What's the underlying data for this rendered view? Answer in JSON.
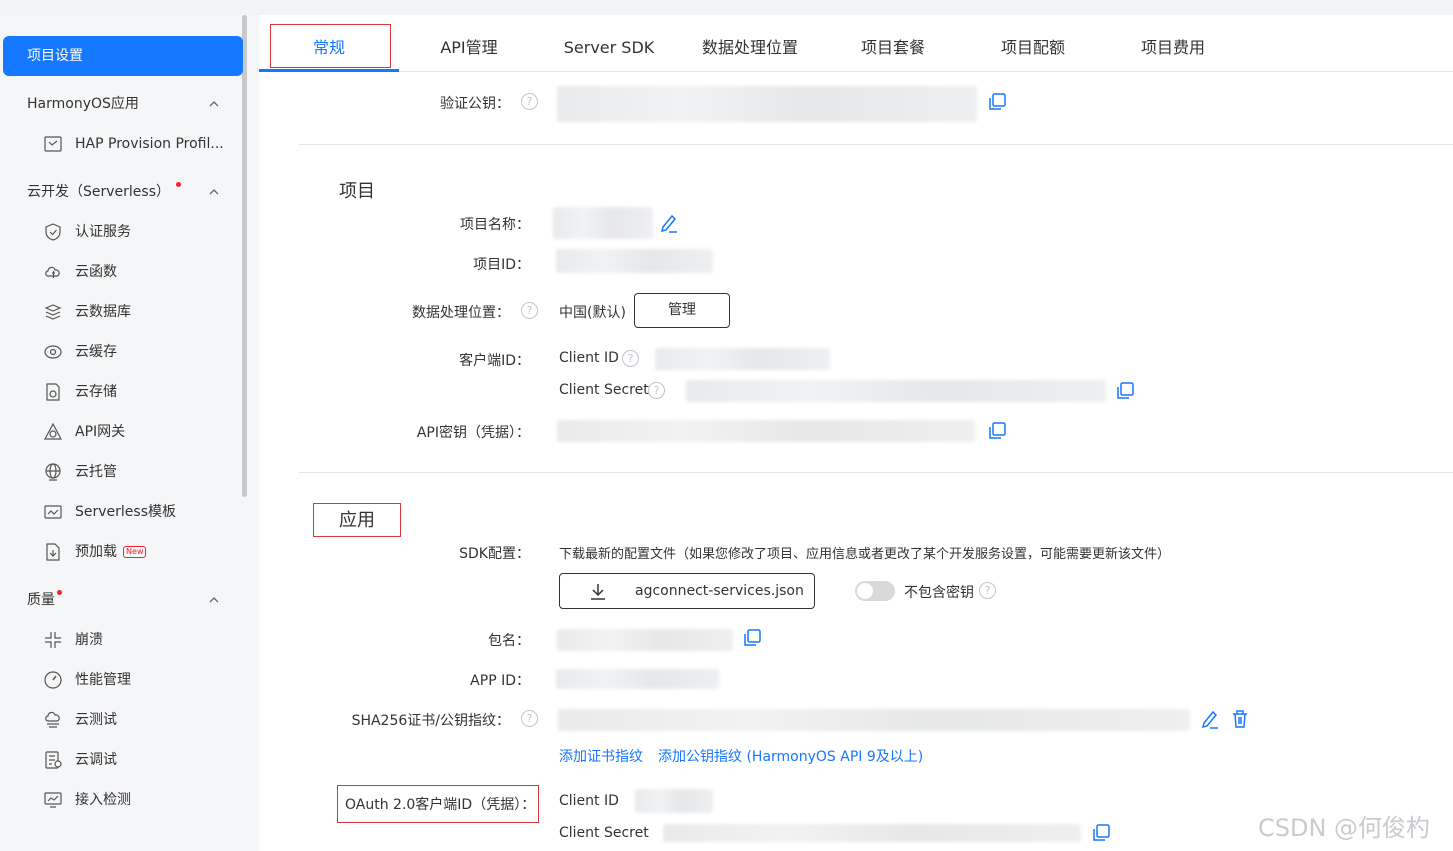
{
  "sidebar": {
    "active": "项目设置",
    "groups": [
      {
        "label": "HarmonyOS应用",
        "dot": false
      },
      {
        "label": "云开发（Serverless）",
        "dot": true
      },
      {
        "label": "质量",
        "dot": true
      }
    ],
    "items": [
      {
        "label": "HAP Provision Profil...",
        "icon": "profile-icon"
      },
      {
        "label": "认证服务",
        "icon": "shield-icon"
      },
      {
        "label": "云函数",
        "icon": "cloud-function-icon"
      },
      {
        "label": "云数据库",
        "icon": "database-icon"
      },
      {
        "label": "云缓存",
        "icon": "cache-icon"
      },
      {
        "label": "云存储",
        "icon": "storage-icon"
      },
      {
        "label": "API网关",
        "icon": "gateway-icon"
      },
      {
        "label": "云托管",
        "icon": "globe-icon"
      },
      {
        "label": "Serverless模板",
        "icon": "template-icon"
      },
      {
        "label": "预加载",
        "icon": "preload-icon",
        "badge": "New"
      },
      {
        "label": "崩溃",
        "icon": "crash-icon"
      },
      {
        "label": "性能管理",
        "icon": "gauge-icon"
      },
      {
        "label": "云测试",
        "icon": "cloud-test-icon"
      },
      {
        "label": "云调试",
        "icon": "debug-icon"
      },
      {
        "label": "接入检测",
        "icon": "monitor-icon"
      }
    ]
  },
  "tabs": [
    "常规",
    "API管理",
    "Server SDK",
    "数据处理位置",
    "项目套餐",
    "项目配额",
    "项目费用"
  ],
  "top": {
    "verify_key_label": "验证公钥："
  },
  "project": {
    "title": "项目",
    "name_label": "项目名称：",
    "id_label": "项目ID：",
    "location_label": "数据处理位置：",
    "location_value": "中国(默认)",
    "manage_button": "管理",
    "client_id_label": "客户端ID：",
    "client_id": "Client ID",
    "client_secret": "Client Secret",
    "api_key_label": "API密钥（凭据）："
  },
  "app": {
    "title": "应用",
    "sdk_label": "SDK配置：",
    "sdk_desc": "下载最新的配置文件（如果您修改了项目、应用信息或者更改了某个开发服务设置，可能需要更新该文件）",
    "download_button": "agconnect-services.json",
    "exclude_key_label": "不包含密钥",
    "package_label": "包名：",
    "app_id_label": "APP ID：",
    "sha_label": "SHA256证书/公钥指纹：",
    "add_cert_link": "添加证书指纹",
    "add_pubkey_link": "添加公钥指纹 (HarmonyOS API 9及以上)",
    "oauth_label": "OAuth 2.0客户端ID（凭据）：",
    "oauth_client_id": "Client ID",
    "oauth_client_secret": "Client Secret"
  },
  "watermark": "CSDN @何俊杓",
  "colors": {
    "accent": "#1677ff",
    "highlight_box": "#d9363e"
  }
}
